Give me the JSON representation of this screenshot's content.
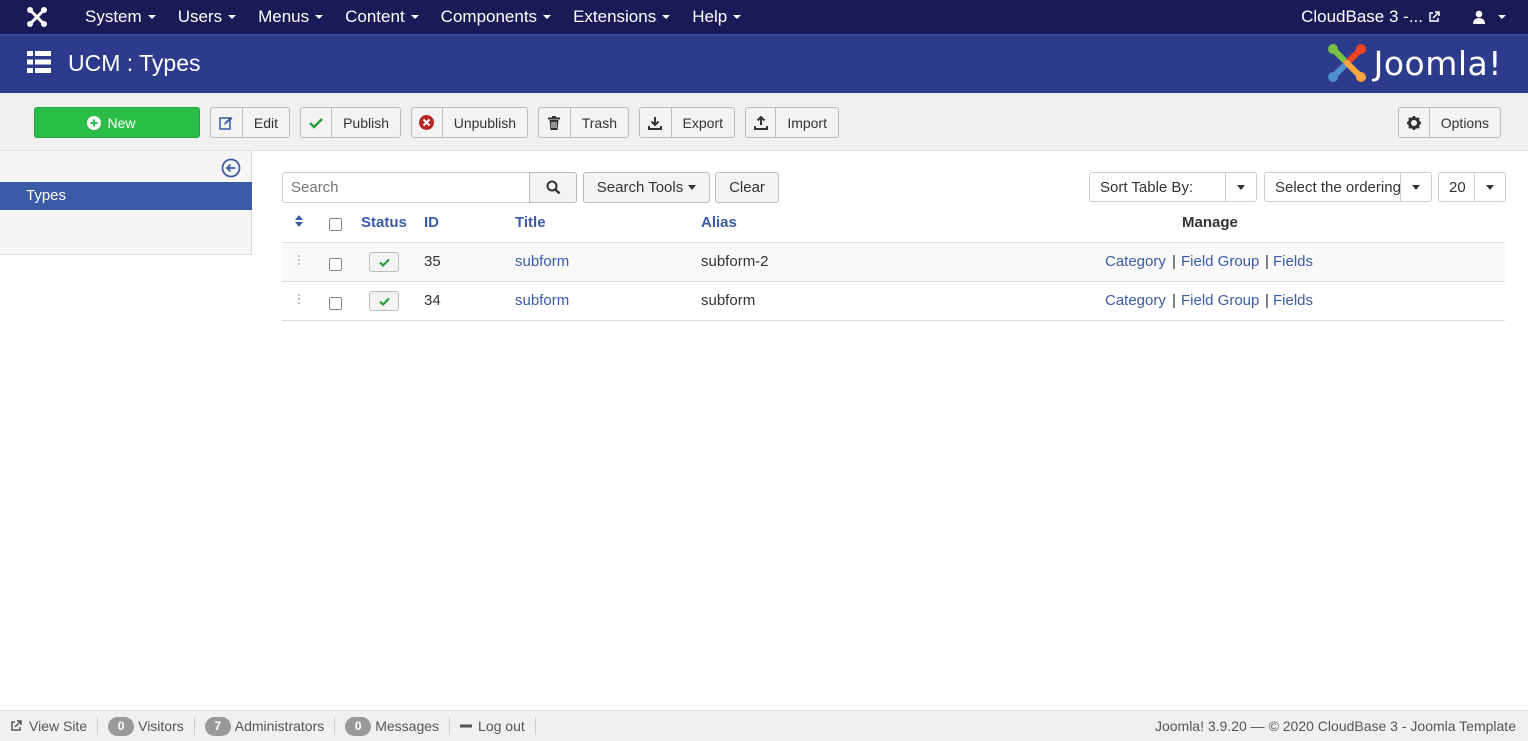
{
  "topnav": {
    "menu": [
      "System",
      "Users",
      "Menus",
      "Content",
      "Components",
      "Extensions",
      "Help"
    ],
    "site_name": "CloudBase 3 -..."
  },
  "header": {
    "title": "UCM : Types",
    "brand": "Joomla!"
  },
  "toolbar": {
    "new": "New",
    "edit": "Edit",
    "publish": "Publish",
    "unpublish": "Unpublish",
    "trash": "Trash",
    "export": "Export",
    "import": "Import",
    "options": "Options"
  },
  "sidebar": {
    "items": [
      "Types"
    ]
  },
  "filters": {
    "search_placeholder": "Search",
    "search_tools": "Search Tools",
    "clear": "Clear",
    "sort_by": "Sort Table By:",
    "ordering": "Select the ordering.",
    "limit": "20"
  },
  "table": {
    "headers": {
      "status": "Status",
      "id": "ID",
      "title": "Title",
      "alias": "Alias",
      "manage": "Manage"
    },
    "rows": [
      {
        "id": "35",
        "title": "subform",
        "alias": "subform-2",
        "category": "Category",
        "field_group": "Field Group",
        "fields": "Fields"
      },
      {
        "id": "34",
        "title": "subform",
        "alias": "subform",
        "category": "Category",
        "field_group": "Field Group",
        "fields": "Fields"
      }
    ],
    "separator": "|"
  },
  "footer": {
    "view_site": "View Site",
    "visitors_count": "0",
    "visitors": "Visitors",
    "admins_count": "7",
    "administrators": "Administrators",
    "messages_count": "0",
    "messages": "Messages",
    "logout": "Log out",
    "copyright": "Joomla! 3.9.20  —  © 2020 CloudBase 3 - Joomla Template"
  },
  "colors": {
    "topnav_bg": "#1a1a56",
    "header_bg": "#2d3b8c",
    "new_button": "#2abd47",
    "link": "#3b5aa8"
  },
  "icons": [
    "joomla-icon",
    "external-link-icon",
    "user-icon",
    "list-icon",
    "plus-circle-icon",
    "edit-icon",
    "check-icon",
    "times-circle-icon",
    "trash-icon",
    "download-icon",
    "upload-icon",
    "gear-icon",
    "arrow-left-circle-icon",
    "search-icon",
    "sort-icon",
    "drag-handle-icon",
    "minus-icon"
  ]
}
